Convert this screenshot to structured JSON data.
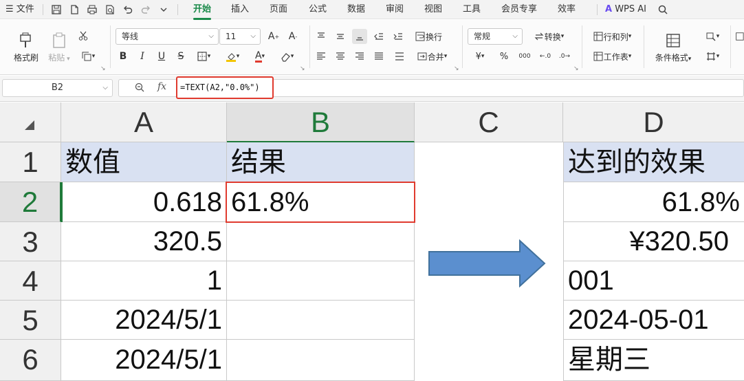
{
  "menubar": {
    "file_label": "文件",
    "tabs": [
      "开始",
      "插入",
      "页面",
      "公式",
      "数据",
      "审阅",
      "视图",
      "工具",
      "会员专享",
      "效率"
    ],
    "wps_ai_label": "WPS AI"
  },
  "ribbon": {
    "format_painter": "格式刷",
    "paste": "粘贴",
    "font_name": "等线",
    "font_size": "11",
    "number_format": "常规",
    "convert": "转换",
    "wrap": "换行",
    "merge": "合并",
    "rows_cols": "行和列",
    "worksheet": "工作表",
    "cond_format": "条件格式",
    "bold": "B",
    "italic": "I",
    "underline": "U",
    "strike": "S",
    "currency": "¥",
    "percent": "%",
    "thousands": "000"
  },
  "formula_bar": {
    "name_box": "B2",
    "fx_label": "fx",
    "formula": "=TEXT(A2,\"0.0%\")"
  },
  "columns": [
    "A",
    "B",
    "C",
    "D"
  ],
  "rows": [
    "1",
    "2",
    "3",
    "4",
    "5",
    "6"
  ],
  "cells": {
    "A1": "数值",
    "B1": "结果",
    "D1": "达到的效果",
    "A2": "0.618",
    "B2": "61.8%",
    "D2": "61.8%",
    "A3": "320.5",
    "D3": "¥320.50",
    "A4": "1",
    "D4": "001",
    "A5": "2024/5/1",
    "D5": "2024-05-01",
    "A6": "2024/5/1",
    "D6": "星期三"
  },
  "colors": {
    "accent_green": "#1b8a4a",
    "highlight_red": "#e03a2e",
    "header_fill": "#d9e1f2",
    "arrow_fill": "#5b8fcf"
  }
}
